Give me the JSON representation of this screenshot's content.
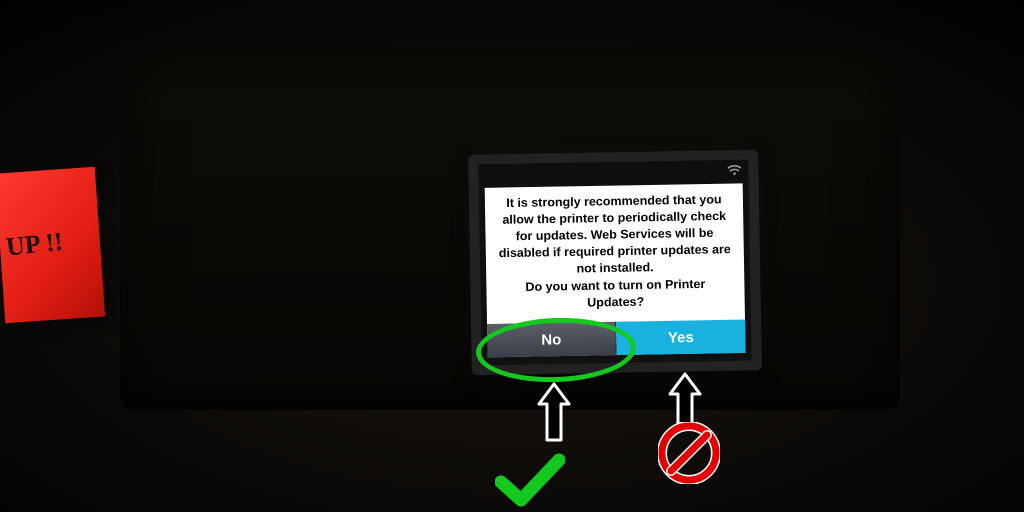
{
  "sticky_note": {
    "text": "UP !!"
  },
  "dialog": {
    "body": "It is strongly recommended that you allow the printer to periodically check for updates. Web Services will be disabled if required printer updates are not installed.",
    "question": "Do you want to turn on Printer Updates?",
    "no_label": "No",
    "yes_label": "Yes"
  },
  "annotations": {
    "circle_target": "no-button",
    "recommended": "No",
    "not_recommended": "Yes"
  },
  "colors": {
    "accent_yes": "#19b2de",
    "accent_no": "#4a4f58",
    "annotation_green": "#14c81e",
    "annotation_red": "#e40000"
  }
}
